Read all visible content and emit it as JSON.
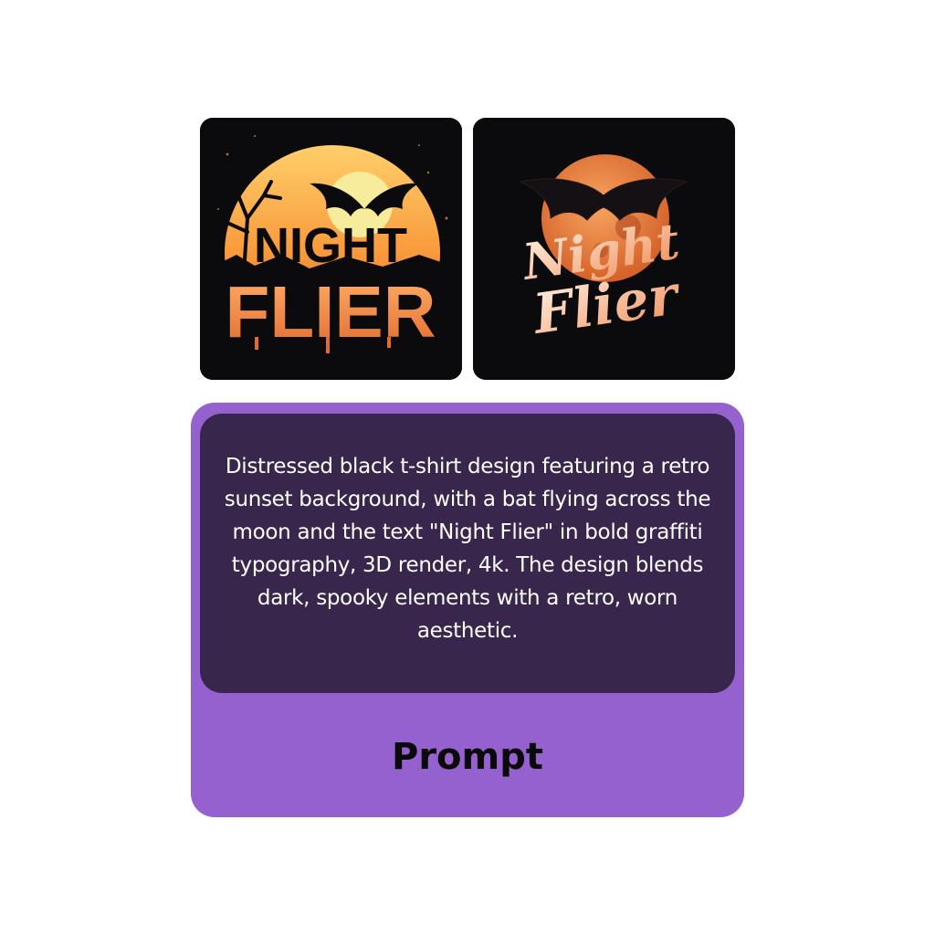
{
  "colors": {
    "page_bg": "#ffffff",
    "accent": "#9461cf",
    "prompt_box": "#39264d",
    "prompt_text": "#ffffff",
    "label_text": "#0a0a0a"
  },
  "images": [
    {
      "lines": [
        "NIGHT",
        "FLIER"
      ],
      "style": "distressed-block"
    },
    {
      "lines": [
        "Night",
        "Flier"
      ],
      "style": "brush-script"
    }
  ],
  "prompt": {
    "text": "Distressed black t-shirt design featuring a retro sunset background, with a bat flying across the moon and the text \"Night Flier\" in bold graffiti typography, 3D render, 4k. The design blends dark, spooky elements with a retro, worn aesthetic.",
    "label": "Prompt"
  }
}
